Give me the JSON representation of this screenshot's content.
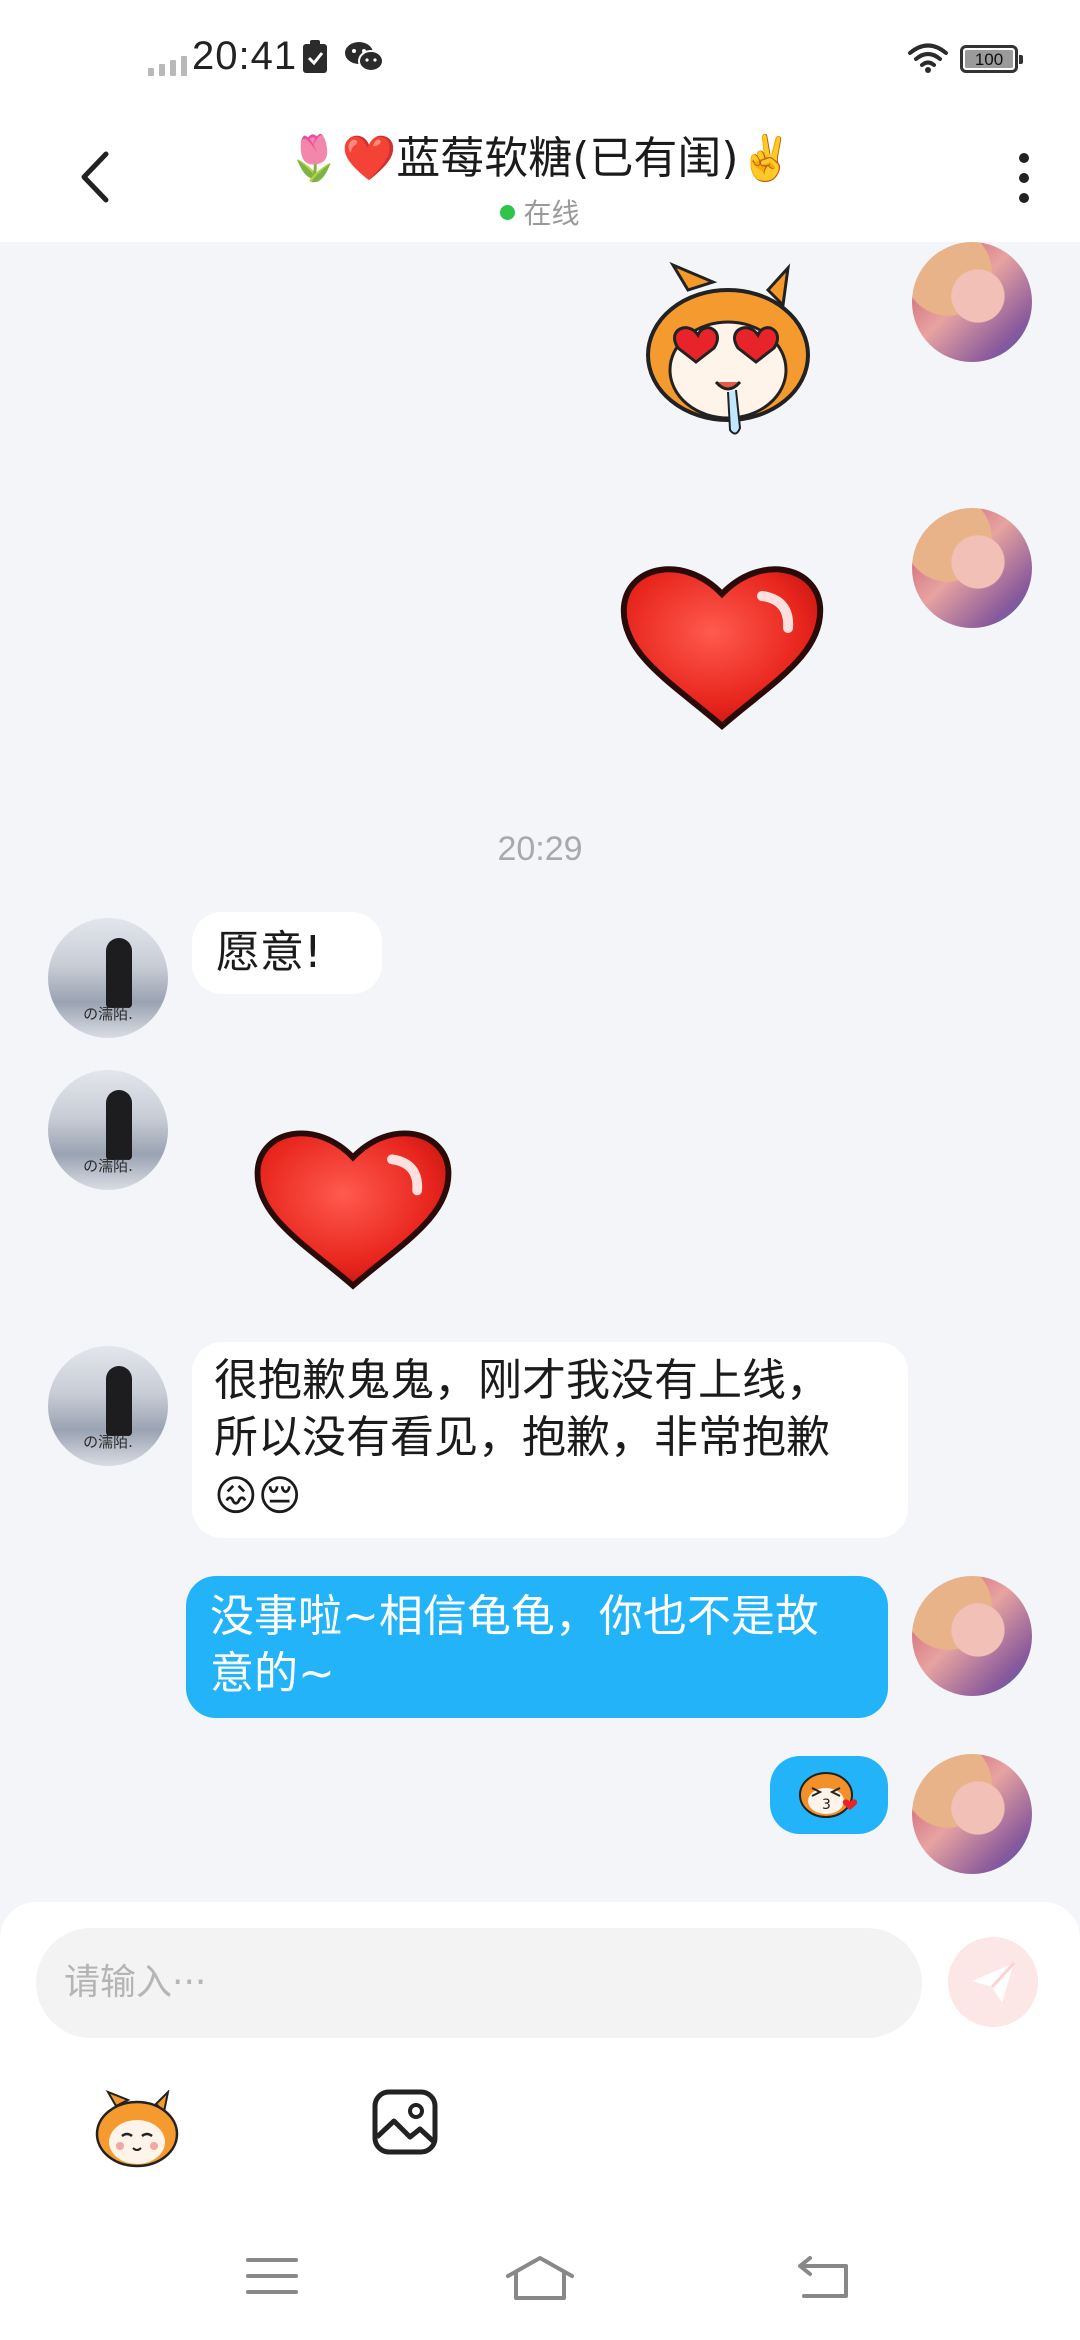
{
  "status_bar": {
    "time": "20:41",
    "battery": "100"
  },
  "header": {
    "title": "🌷❤️蓝莓软糖(已有闺)✌️",
    "status": "在线"
  },
  "chat": {
    "timestamp": "20:29",
    "messages": [
      {
        "sender": "other",
        "text": "愿意!"
      },
      {
        "sender": "other",
        "text_line1": "很抱歉鬼鬼，刚才我没有上线，",
        "text_line2": "所以没有看见，抱歉，非常抱歉",
        "emojis": "😖😔"
      },
      {
        "sender": "me",
        "text_line1": "没事啦~相信龟龟，你也不是故",
        "text_line2": "意的~"
      }
    ],
    "other_avatar_caption": "の濡陌."
  },
  "composer": {
    "placeholder": "请输入···"
  },
  "icons": {
    "back": "back-arrow-icon",
    "more": "more-vertical-icon",
    "send": "send-icon",
    "emoji": "emoji-sticker-icon",
    "image": "image-icon",
    "nav_menu": "menu-icon",
    "nav_home": "home-icon",
    "nav_back": "return-icon"
  },
  "colors": {
    "outgoing_bubble": "#22b3f8",
    "incoming_bubble": "#ffffff",
    "background": "#f4f5f9",
    "online": "#2ec54a"
  }
}
